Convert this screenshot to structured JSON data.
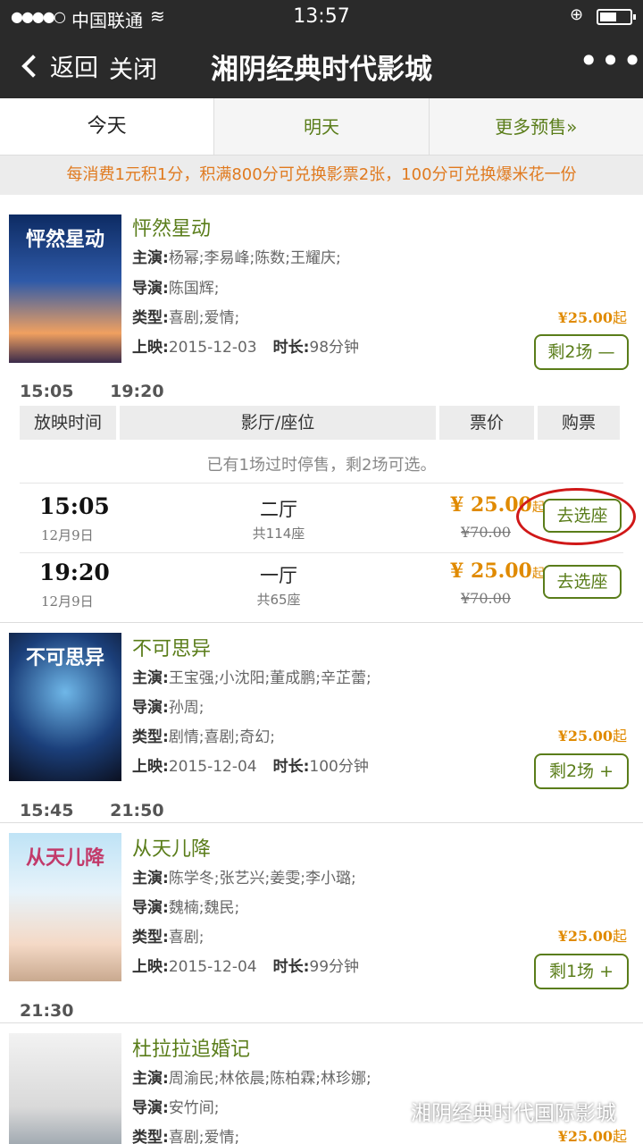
{
  "status": {
    "carrier": "中国联通",
    "time": "13:57",
    "battery_level": 0.55
  },
  "nav": {
    "back": "返回",
    "close": "关闭",
    "title": "湘阴经典时代影城"
  },
  "tabs": {
    "today": "今天",
    "tomorrow": "明天",
    "presale": "更多预售»"
  },
  "promo": "每消费1元积1分，积满800分可兑换影票2张，100分可兑换爆米花一份",
  "labels": {
    "starring": "主演:",
    "director": "导演:",
    "genre": "类型:",
    "release": "上映:",
    "duration": "时长:",
    "from": "起"
  },
  "movies": [
    {
      "title": "怦然星动",
      "poster_title": "怦然星动",
      "cast": "杨幂;李易峰;陈数;王耀庆;",
      "director": "陈国辉;",
      "genre": "喜剧;爱情;",
      "release": "2015-12-03",
      "duration": "98分钟",
      "price": "¥25.00",
      "shows_btn": "剩2场 —",
      "times": [
        "15:05",
        "19:20"
      ]
    },
    {
      "title": "不可思异",
      "poster_title": "不可思异",
      "cast": "王宝强;小沈阳;董成鹏;辛芷蕾;",
      "director": "孙周;",
      "genre": "剧情;喜剧;奇幻;",
      "release": "2015-12-04",
      "duration": "100分钟",
      "price": "¥25.00",
      "shows_btn": "剩2场 +",
      "times": [
        "15:45",
        "21:50"
      ]
    },
    {
      "title": "从天儿降",
      "poster_title": "从天儿降",
      "cast": "陈学冬;张艺兴;姜雯;李小璐;",
      "director": "魏楠;魏民;",
      "genre": "喜剧;",
      "release": "2015-12-04",
      "duration": "99分钟",
      "price": "¥25.00",
      "shows_btn": "剩1场 +",
      "times": [
        "21:30"
      ]
    },
    {
      "title": "杜拉拉追婚记",
      "cast": "周渝民;林依晨;陈柏霖;林珍娜;",
      "director": "安竹间;",
      "genre": "喜剧;爱情;",
      "price": "¥25.00"
    }
  ],
  "schedule": {
    "headers": [
      "放映时间",
      "影厅/座位",
      "票价",
      "购票"
    ],
    "note": "已有1场过时停售，剩2场可选。",
    "rows": [
      {
        "time": "15:05",
        "date": "12月9日",
        "hall": "二厅",
        "seats": "共114座",
        "price": "¥ 25.00",
        "orig": "¥70.00",
        "button": "去选座"
      },
      {
        "time": "19:20",
        "date": "12月9日",
        "hall": "一厅",
        "seats": "共65座",
        "price": "¥ 25.00",
        "orig": "¥70.00",
        "button": "去选座"
      }
    ]
  },
  "watermark": "湘阴经典时代国际影城"
}
